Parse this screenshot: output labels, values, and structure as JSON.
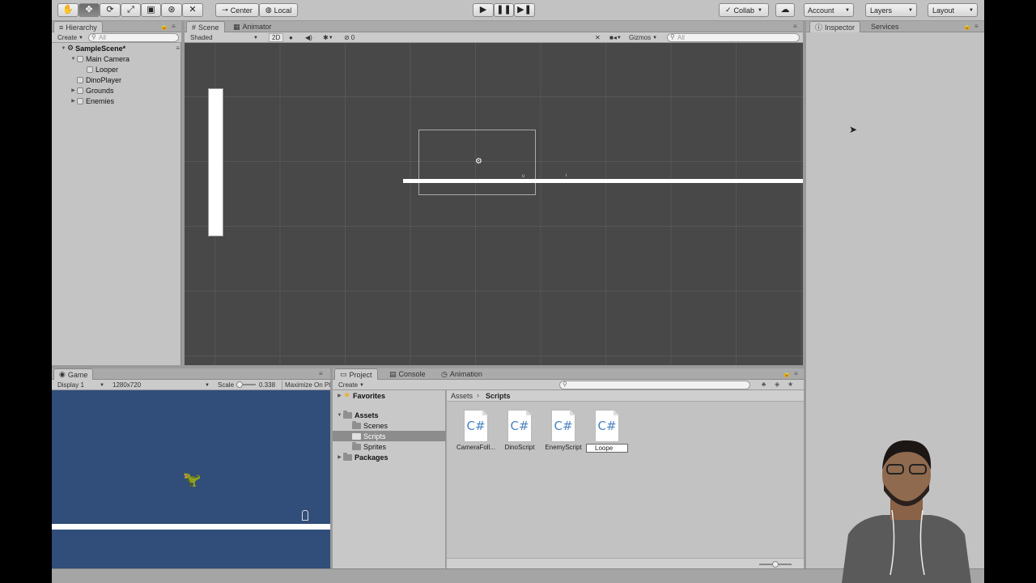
{
  "toolbar": {
    "pivot_label": "Center",
    "space_label": "Local",
    "collab_label": "Collab",
    "account_label": "Account",
    "layers_label": "Layers",
    "layout_label": "Layout"
  },
  "hierarchy": {
    "tab": "Hierarchy",
    "create_label": "Create",
    "search_placeholder": "All",
    "scene_name": "SampleScene*",
    "items": [
      {
        "label": "Main Camera"
      },
      {
        "label": "Looper"
      },
      {
        "label": "DinoPlayer"
      },
      {
        "label": "Grounds"
      },
      {
        "label": "Enemies"
      }
    ]
  },
  "scene": {
    "tabs": [
      "Scene",
      "Animator"
    ],
    "shading": "Shaded",
    "mode_2d": "2D",
    "effects_count": "0",
    "gizmos": "Gizmos",
    "search_placeholder": "All"
  },
  "game": {
    "tab": "Game",
    "display": "Display 1",
    "resolution": "1280x720",
    "scale_label": "Scale",
    "scale_value": "0.338",
    "maximize_label": "Maximize On Pl"
  },
  "project": {
    "tabs": [
      "Project",
      "Console",
      "Animation"
    ],
    "create_label": "Create",
    "tree": {
      "favorites": "Favorites",
      "assets": "Assets",
      "folders": [
        "Scenes",
        "Scripts",
        "Sprites"
      ],
      "packages": "Packages"
    },
    "breadcrumb": [
      "Assets",
      "Scripts"
    ],
    "scripts": [
      {
        "icon_text": "C#",
        "name": "CameraFoll..."
      },
      {
        "icon_text": "C#",
        "name": "DinoScript"
      },
      {
        "icon_text": "C#",
        "name": "EnemyScript"
      },
      {
        "icon_text": "C#",
        "name": "Loope"
      }
    ]
  },
  "inspector": {
    "tabs": [
      "Inspector",
      "Services"
    ]
  },
  "colors": {
    "scene_bg": "#484848",
    "game_bg": "#314d79",
    "csharp_icon": "#4b82c3"
  }
}
